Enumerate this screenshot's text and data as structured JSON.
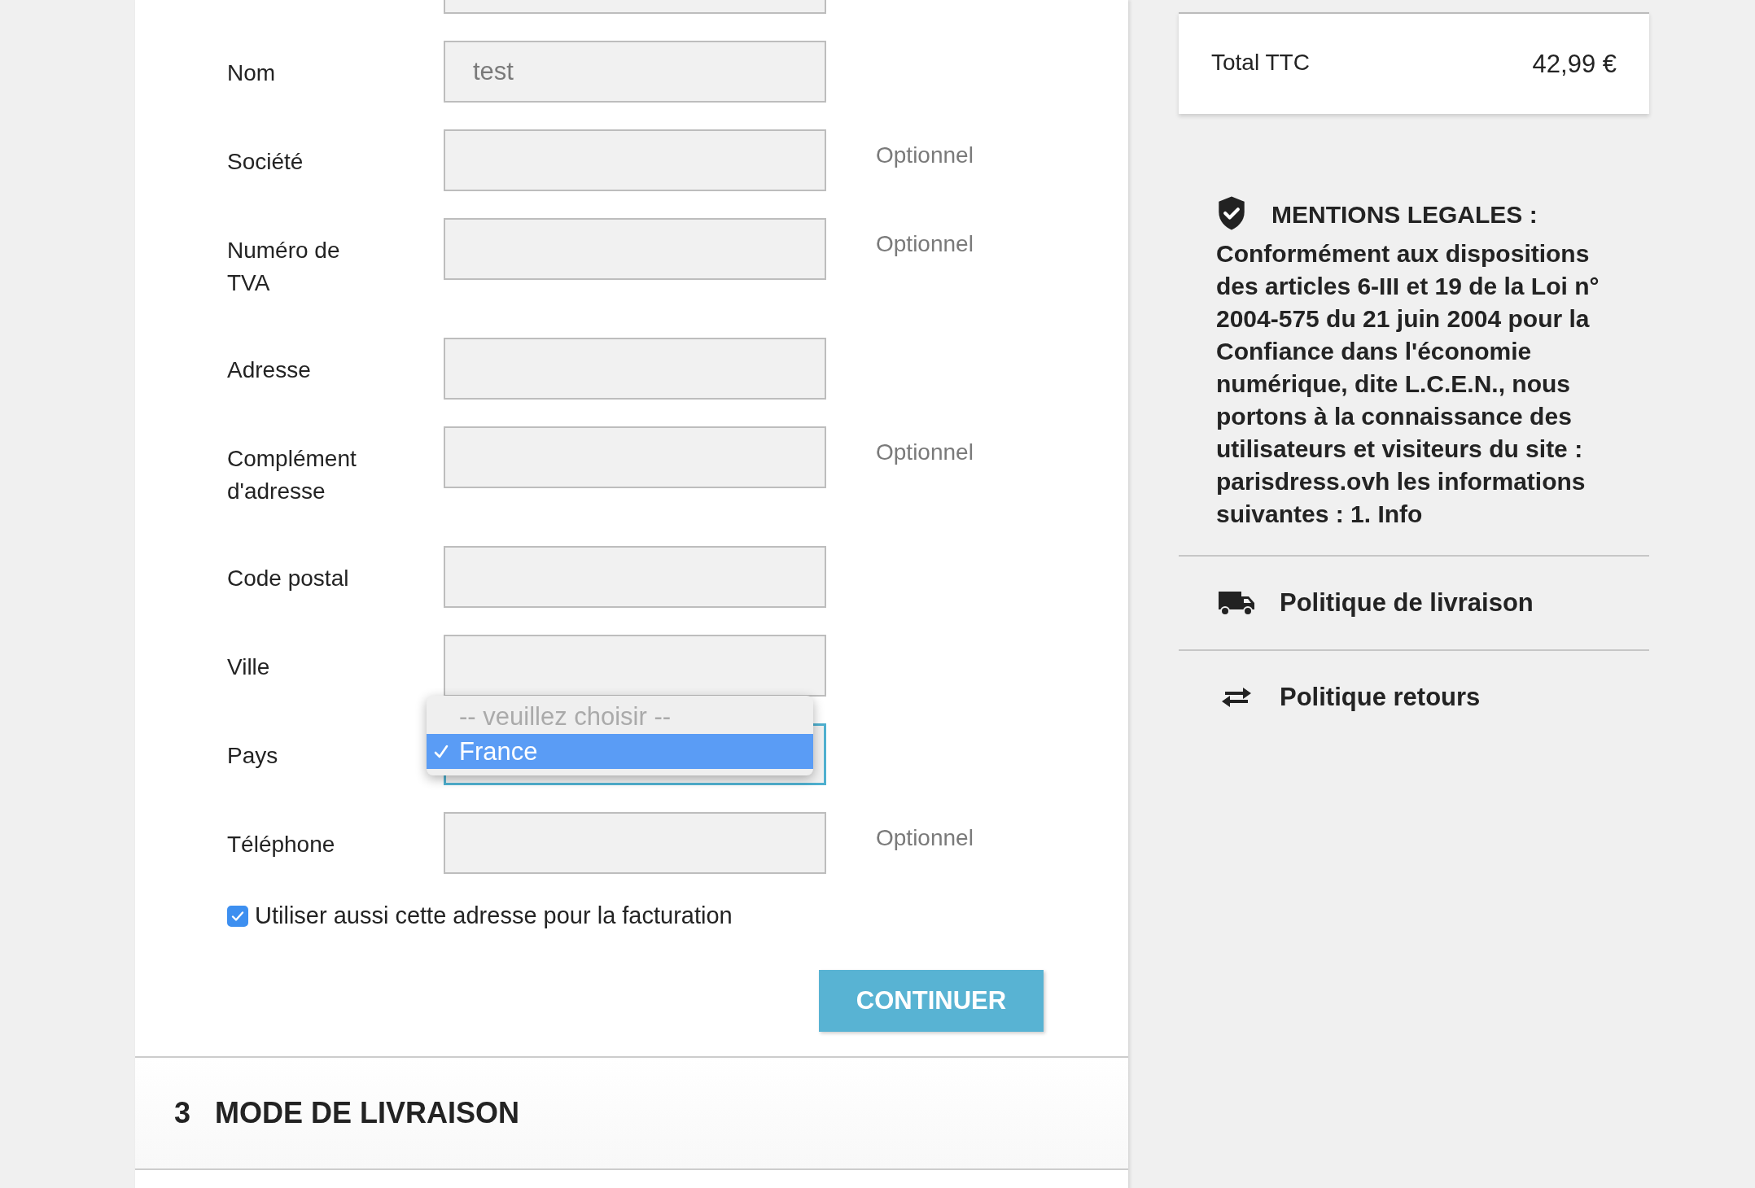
{
  "form": {
    "fields": [
      {
        "kind": "cut"
      },
      {
        "kind": "text",
        "label": "Nom",
        "value": "test"
      },
      {
        "kind": "text",
        "label": "Société",
        "note": "Optionnel"
      },
      {
        "kind": "text",
        "label": "Numéro de TVA",
        "note": "Optionnel"
      },
      {
        "kind": "text",
        "label": "Adresse"
      },
      {
        "kind": "text",
        "label": "Complément d'adresse",
        "note": "Optionnel"
      },
      {
        "kind": "text",
        "label": "Code postal"
      },
      {
        "kind": "text",
        "label": "Ville"
      },
      {
        "kind": "select",
        "label": "Pays",
        "focused": true,
        "expanded": true,
        "options": [
          {
            "label": "-- veuillez choisir --",
            "selected": false,
            "disabled": true
          },
          {
            "label": "France",
            "selected": true,
            "disabled": false
          }
        ]
      },
      {
        "kind": "text",
        "label": "Téléphone",
        "note": "Optionnel"
      }
    ],
    "billing_checkbox": {
      "label": "Utiliser aussi cette adresse pour la facturation",
      "checked": true
    },
    "submit_button": "CONTINUER"
  },
  "next_section": {
    "number": "3",
    "title": "MODE DE LIVRAISON"
  },
  "summary": {
    "total_label": "Total TTC",
    "total_value": "42,99 €"
  },
  "legal": {
    "title": "MENTIONS LEGALES :",
    "text": "Conformément aux dispositions des articles 6-III et 19 de la Loi n° 2004-575 du 21 juin 2004 pour la Confiance dans l'économie numérique, dite L.C.E.N., nous portons à la connaissance des utilisateurs et visiteurs du site : parisdress.ovh les informations suivantes : 1. Info"
  },
  "policy_links": [
    {
      "kind": "truck",
      "label": "Politique de livraison"
    },
    {
      "kind": "arrows",
      "label": "Politique retours"
    }
  ]
}
